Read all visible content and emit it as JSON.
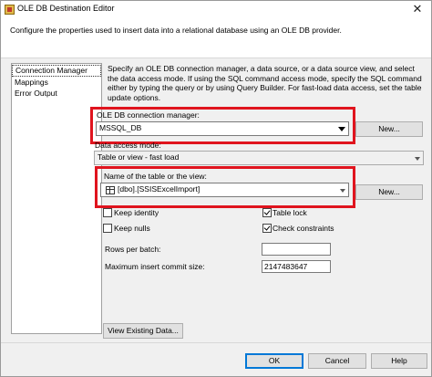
{
  "window": {
    "title": "OLE DB Destination Editor",
    "close_glyph": "✕"
  },
  "header": {
    "description": "Configure the properties used to insert data into a relational database using an OLE DB provider."
  },
  "nav": {
    "items": [
      "Connection Manager",
      "Mappings",
      "Error Output"
    ],
    "selected_index": 0
  },
  "main": {
    "info": "Specify an OLE DB connection manager, a data source, or a data source view, and select the data access mode. If using the SQL command access mode, specify the SQL command either by typing the query or by using Query Builder. For fast-load data access, set the table update options.",
    "connection_manager": {
      "label": "OLE DB connection manager:",
      "value": "MSSQL_DB",
      "new_button": "New..."
    },
    "data_access_mode": {
      "label": "Data access mode:",
      "value": "Table or view - fast load"
    },
    "table": {
      "label": "Name of the table or the view:",
      "value": "[dbo].[SSISExcelImport]",
      "new_button": "New..."
    },
    "options": {
      "keep_identity": {
        "label": "Keep identity",
        "checked": false
      },
      "table_lock": {
        "label": "Table lock",
        "checked": true
      },
      "keep_nulls": {
        "label": "Keep nulls",
        "checked": false
      },
      "check_constraints": {
        "label": "Check constraints",
        "checked": true
      }
    },
    "rows_per_batch": {
      "label": "Rows per batch:",
      "value": ""
    },
    "max_insert_commit_size": {
      "label": "Maximum insert commit size:",
      "value": "2147483647"
    },
    "view_existing_button": "View Existing Data..."
  },
  "footer": {
    "ok": "OK",
    "cancel": "Cancel",
    "help": "Help"
  },
  "colors": {
    "highlight_border": "#e0141e",
    "default_button_border": "#0078d7"
  }
}
